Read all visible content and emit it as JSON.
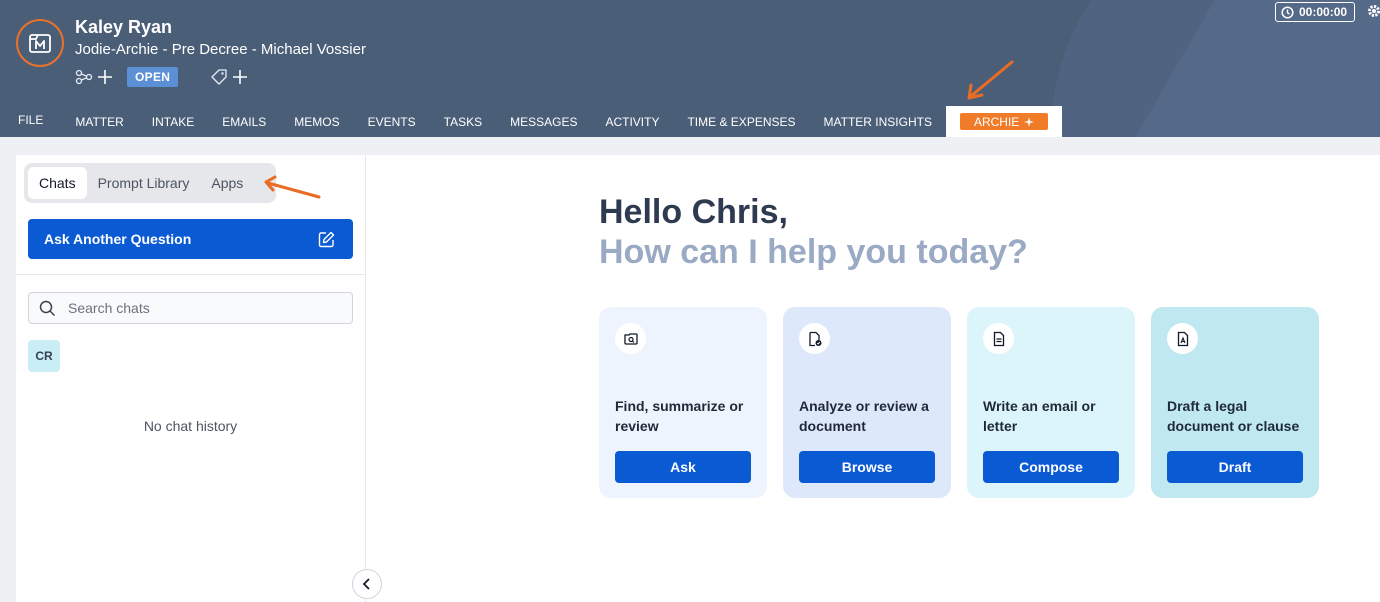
{
  "header": {
    "client_name": "Kaley Ryan",
    "matter_name": "Jodie-Archie - Pre Decree - Michael Vossier",
    "status": "OPEN",
    "timer": "00:00:00",
    "icons": [
      "matter-logo-icon",
      "relationship-icon",
      "add-icon",
      "tag-icon",
      "add-icon",
      "clock-icon",
      "gear-icon"
    ]
  },
  "nav": {
    "items": [
      "FILE",
      "MATTER",
      "INTAKE",
      "EMAILS",
      "MEMOS",
      "EVENTS",
      "TASKS",
      "MESSAGES",
      "ACTIVITY",
      "TIME & EXPENSES",
      "MATTER INSIGHTS"
    ],
    "active": "ARCHIE"
  },
  "sidebar": {
    "tabs": [
      "Chats",
      "Prompt Library",
      "Apps"
    ],
    "active_tab": "Chats",
    "ask_button": "Ask Another Question",
    "search_placeholder": "Search chats",
    "user_initials": "CR",
    "empty": "No chat history"
  },
  "main": {
    "greeting": "Hello Chris,",
    "subgreeting": "How can I help you today?",
    "cards": [
      {
        "title": "Find, summarize or review",
        "button": "Ask",
        "icon": "search-document-icon",
        "bg": "#eef4fd"
      },
      {
        "title": "Analyze or review a document",
        "button": "Browse",
        "icon": "analyze-document-icon",
        "bg": "#dde9fb"
      },
      {
        "title": "Write an email or letter",
        "button": "Compose",
        "icon": "document-text-icon",
        "bg": "#dcf5fa"
      },
      {
        "title": "Draft a legal document or clause",
        "button": "Draft",
        "icon": "legal-document-icon",
        "bg": "#bfe8f0"
      }
    ]
  },
  "colors": {
    "header_bg": "#4b5e78",
    "accent_orange": "#f07c2a",
    "primary_blue": "#0a5ad4",
    "status_blue": "#5b8fd6"
  }
}
